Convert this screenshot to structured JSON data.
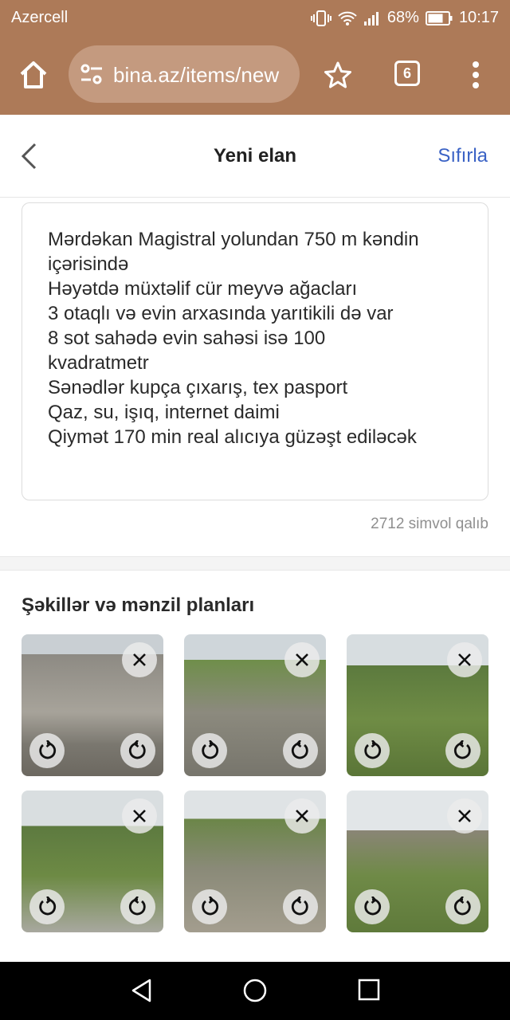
{
  "status_bar": {
    "carrier": "Azercell",
    "battery": "68%",
    "time": "10:17"
  },
  "browser": {
    "url": "bina.az/items/new",
    "tab_count": "6",
    "icons": [
      "home-icon",
      "site-settings-icon",
      "star-icon",
      "tabs-icon",
      "more-icon"
    ]
  },
  "header": {
    "title": "Yeni elan",
    "reset_label": "Sıfırla"
  },
  "description": {
    "lines": [
      "Mərdəkan Magistral yolundan 750 m kəndin",
      "içərisində",
      "Həyətdə müxtəlif cür meyvə ağacları",
      "3 otaqlı və evin arxasında yarıtikili də var",
      "8 sot sahədə evin sahəsi isə 100",
      "kvadratmetr",
      "Sənədlər kupça çıxarış, tex pasport",
      "Qaz, su, işıq, internet daimi",
      "Qiymət 170 min real alıcıya güzəşt ediləcək"
    ],
    "remaining": "2712 simvol qalıb"
  },
  "photos": {
    "title": "Şəkillər və mənzil planları",
    "count": 6
  },
  "colors": {
    "browser_bar": "#ad7a58",
    "link_blue": "#3a62c5"
  }
}
